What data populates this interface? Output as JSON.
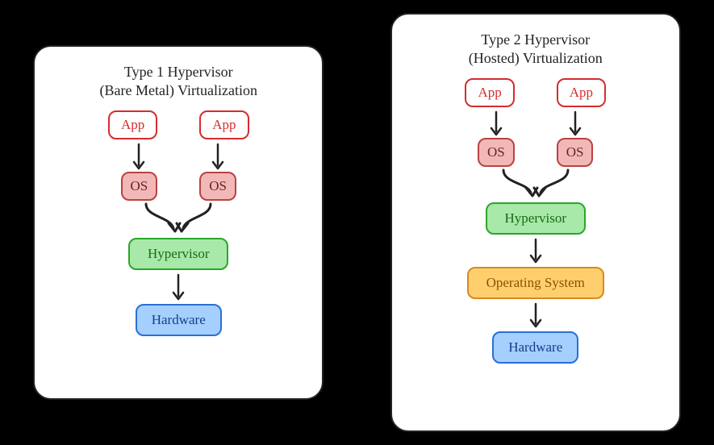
{
  "type1": {
    "title_line1": "Type 1 Hypervisor",
    "title_line2": "(Bare Metal) Virtualization",
    "app": "App",
    "os": "OS",
    "hypervisor": "Hypervisor",
    "hardware": "Hardware"
  },
  "type2": {
    "title_line1": "Type 2 Hypervisor",
    "title_line2": "(Hosted) Virtualization",
    "app": "App",
    "os": "OS",
    "hypervisor": "Hypervisor",
    "host_os": "Operating System",
    "hardware": "Hardware"
  }
}
